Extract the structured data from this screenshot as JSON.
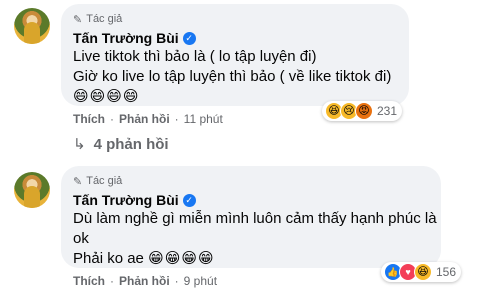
{
  "comments": [
    {
      "author_tag": "Tác giả",
      "author_name": "Tấn Trường Bùi",
      "lines": [
        "Live tiktok thì bảo là ( lo tập luyện đi)",
        "Giờ ko live lo tập luyện thì bảo ( về like tiktok đi)"
      ],
      "emojis": "😄😄😄😄",
      "like_label": "Thích",
      "reply_label": "Phản hồi",
      "time": "11 phút",
      "reaction_icons": [
        "haha-icon",
        "sad-icon",
        "angry-icon"
      ],
      "reaction_count": "231",
      "replies_label": "4 phản hồi"
    },
    {
      "author_tag": "Tác giả",
      "author_name": "Tấn Trường Bùi",
      "lines": [
        "Dù làm nghề gì miễn mình luôn cảm thấy hạnh phúc là",
        "ok",
        "Phải ko ae"
      ],
      "emojis": "😁😁😁😁",
      "like_label": "Thích",
      "reply_label": "Phản hồi",
      "time": "9 phút",
      "reaction_icons": [
        "like-icon",
        "love-icon",
        "haha-icon"
      ],
      "reaction_count": "156"
    }
  ]
}
